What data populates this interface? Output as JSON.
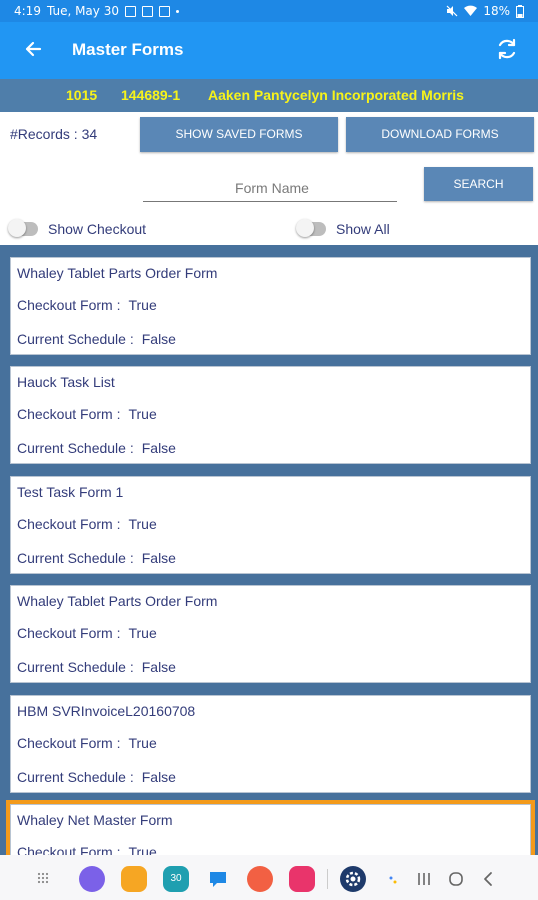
{
  "status_bar": {
    "time": "4:19",
    "date": "Tue, May 30",
    "battery": "18%"
  },
  "app_bar": {
    "title": "Master Forms"
  },
  "customer": {
    "id": "1015",
    "account": "144689-1",
    "name": "Aaken Pantycelyn Incorporated Morris"
  },
  "records_label": "#Records : 34",
  "buttons": {
    "show_saved": "SHOW SAVED FORMS",
    "download": "DOWNLOAD FORMS",
    "search": "SEARCH"
  },
  "search": {
    "placeholder": "Form Name",
    "value": ""
  },
  "toggles": {
    "show_checkout": "Show Checkout",
    "show_all": "Show All"
  },
  "field_labels": {
    "checkout": "Checkout Form :",
    "schedule": "Current Schedule :"
  },
  "forms": [
    {
      "name": "Whaley Tablet Parts Order Form",
      "checkout": "True",
      "schedule": "False"
    },
    {
      "name": "Hauck Task List",
      "checkout": "True",
      "schedule": "False"
    },
    {
      "name": "Test Task Form 1",
      "checkout": "True",
      "schedule": "False"
    },
    {
      "name": "Whaley Tablet Parts Order Form",
      "checkout": "True",
      "schedule": "False"
    },
    {
      "name": "HBM SVRInvoiceL20160708",
      "checkout": "True",
      "schedule": "False"
    },
    {
      "name": "Whaley Net Master Form",
      "checkout": "True",
      "schedule": ""
    }
  ],
  "nav": {
    "calendar_day": "30"
  },
  "colors": {
    "status_bar": "#1e88e5",
    "app_bar": "#2196f3",
    "customer_bar": "#4f7eaa",
    "customer_text": "#f7f31a",
    "list_background": "#47719c",
    "button": "#5a87b6",
    "selected_outline": "#f39a1b"
  }
}
